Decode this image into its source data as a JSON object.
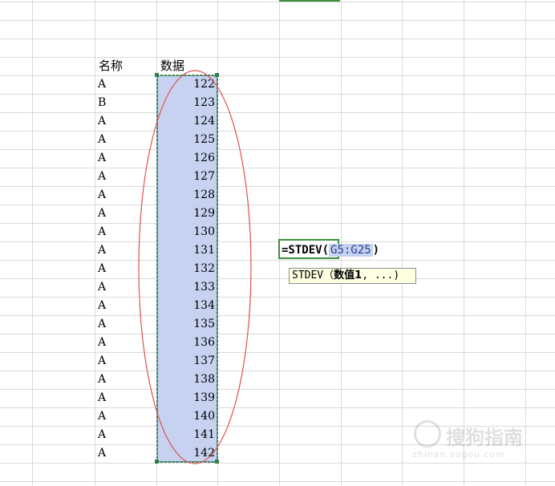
{
  "headers": {
    "name": "名称",
    "data": "数据"
  },
  "rows": [
    {
      "name": "A",
      "value": "122"
    },
    {
      "name": "B",
      "value": "123"
    },
    {
      "name": "A",
      "value": "124"
    },
    {
      "name": "A",
      "value": "125"
    },
    {
      "name": "A",
      "value": "126"
    },
    {
      "name": "A",
      "value": "127"
    },
    {
      "name": "A",
      "value": "128"
    },
    {
      "name": "A",
      "value": "129"
    },
    {
      "name": "A",
      "value": "130"
    },
    {
      "name": "A",
      "value": "131"
    },
    {
      "name": "A",
      "value": "132"
    },
    {
      "name": "A",
      "value": "133"
    },
    {
      "name": "A",
      "value": "134"
    },
    {
      "name": "A",
      "value": "135"
    },
    {
      "name": "A",
      "value": "136"
    },
    {
      "name": "A",
      "value": "137"
    },
    {
      "name": "A",
      "value": "138"
    },
    {
      "name": "A",
      "value": "139"
    },
    {
      "name": "A",
      "value": "140"
    },
    {
      "name": "A",
      "value": "141"
    },
    {
      "name": "A",
      "value": "142"
    }
  ],
  "formula": {
    "prefix": "=STDEV(",
    "range": "G5:G25",
    "suffix": ")"
  },
  "tooltip": {
    "fn": "STDEV",
    "open": "（",
    "arg": "数值1",
    "rest": ", ...)"
  },
  "watermark": {
    "brand": "搜狗指南",
    "url": "zhinan.sogou.com"
  },
  "colors": {
    "selection": "#c6d2f0",
    "active_border": "#3b8e3b",
    "annotation": "#e05050"
  }
}
